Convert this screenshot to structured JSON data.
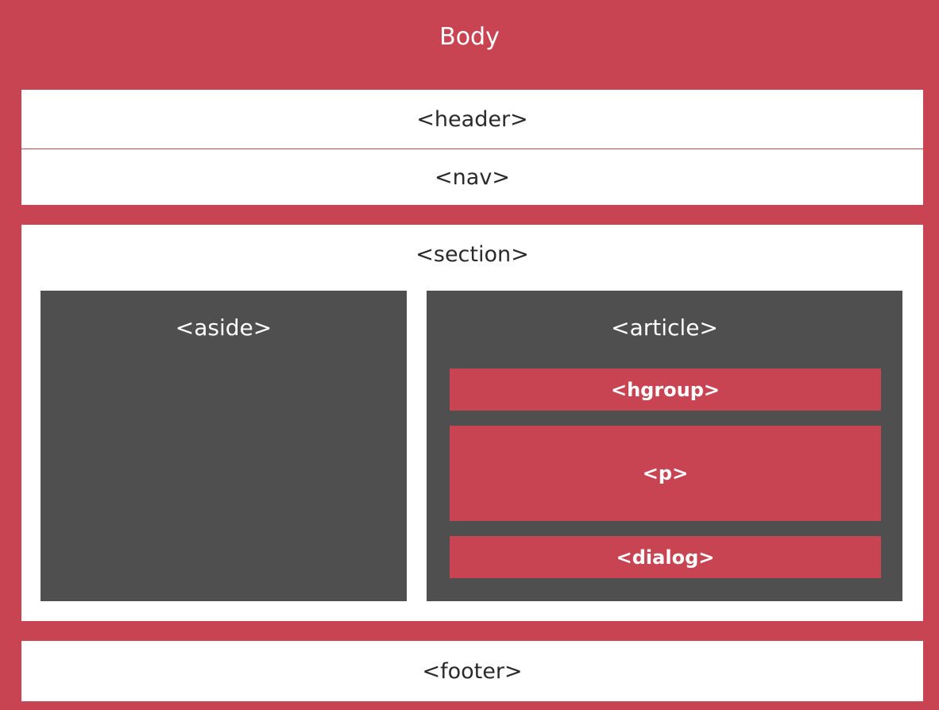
{
  "diagram": {
    "body_label": "Body",
    "header_label": "<header>",
    "nav_label": "<nav>",
    "section_label": "<section>",
    "aside_label": "<aside>",
    "article_label": "<article>",
    "hgroup_label": "<hgroup>",
    "p_label": "<p>",
    "dialog_label": "<dialog>",
    "footer_label": "<footer>"
  },
  "colors": {
    "body_background": "#c84452",
    "box_white": "#ffffff",
    "box_dark": "#4f4f4f",
    "box_red": "#c84452"
  }
}
